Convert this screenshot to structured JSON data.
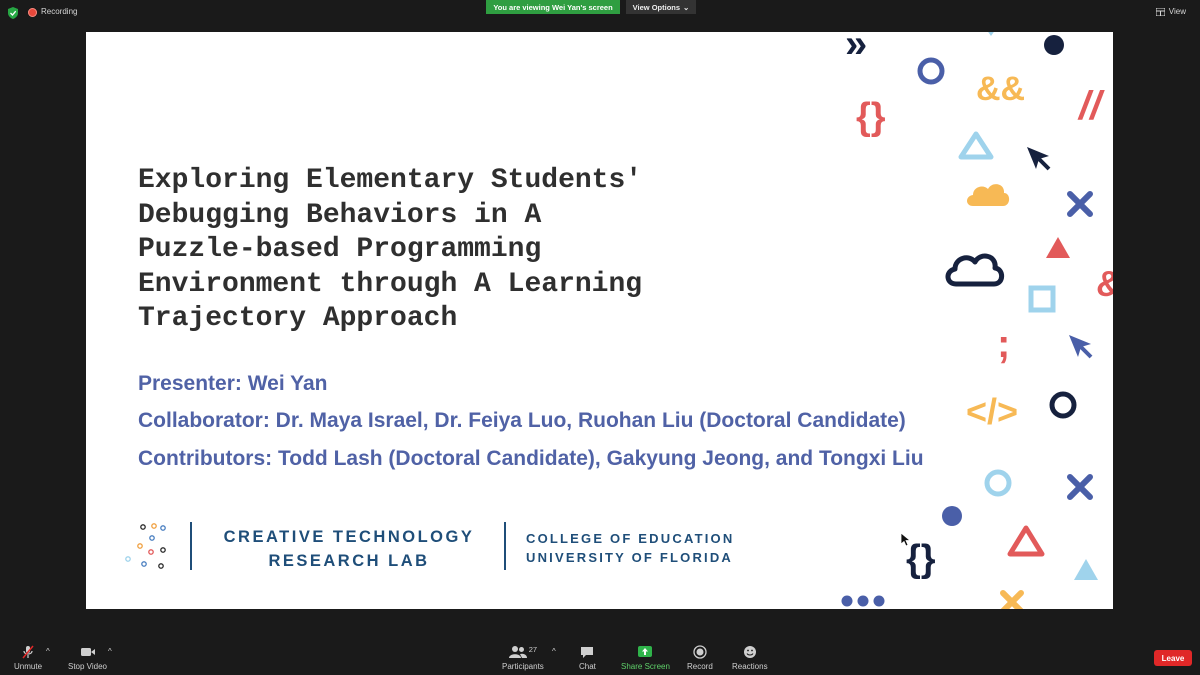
{
  "topbar": {
    "recording_label": "Recording",
    "viewing_banner": "You are viewing Wei Yan's screen",
    "view_options_label": "View Options",
    "view_label": "View"
  },
  "slide": {
    "title": "Exploring Elementary Students'\nDebugging Behaviors in A\nPuzzle-based Programming\nEnvironment through A Learning\nTrajectory Approach",
    "presenter": "Presenter: Wei Yan",
    "collaborator": "Collaborator: Dr. Maya Israel, Dr. Feiya Luo, Ruohan Liu (Doctoral Candidate)",
    "contributors": "Contributors: Todd Lash (Doctoral Candidate), Gakyung Jeong, and Tongxi Liu",
    "lab_line1": "CREATIVE TECHNOLOGY",
    "lab_line2": "RESEARCH LAB",
    "college_line1": "COLLEGE OF EDUCATION",
    "college_line2": "UNIVERSITY OF FLORIDA",
    "deco": {
      "chevrons": "»",
      "ampersands": "&&",
      "slashes": "//",
      "braces_top": "{}",
      "semicolon": ";",
      "code_tag": "</>",
      "ampersand_edge": "&",
      "braces_bottom": "{}"
    }
  },
  "toolbar": {
    "unmute_label": "Unmute",
    "stop_video_label": "Stop Video",
    "participants_label": "Participants",
    "participants_count": "27",
    "chat_label": "Chat",
    "share_screen_label": "Share Screen",
    "record_label": "Record",
    "reactions_label": "Reactions",
    "leave_label": "Leave"
  },
  "colors": {
    "title_text": "#2f2f2f",
    "body_text": "#5062a6",
    "lab_blue": "#1f4e79",
    "banner_green": "#2f9e41",
    "leave_red": "#e02828",
    "deco_navy": "#16213e",
    "deco_blue": "#4a5fa8",
    "deco_red": "#e25a5a",
    "deco_orange": "#f7b955",
    "deco_lightblue": "#9fd3ec"
  }
}
